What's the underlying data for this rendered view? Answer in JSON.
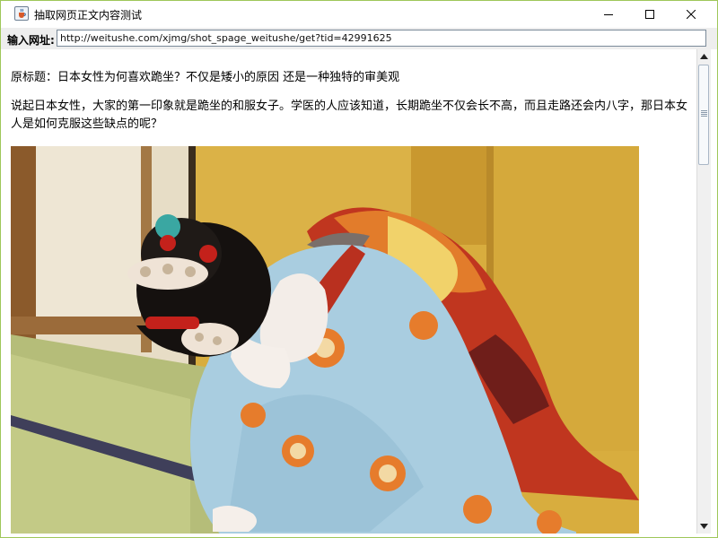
{
  "window": {
    "title": "抽取网页正文内容测试",
    "app_icon": "java-cup-icon",
    "controls": [
      "minimize-icon",
      "maximize-icon",
      "close-icon"
    ]
  },
  "url_bar": {
    "label": "输入网址:",
    "value": "http://weitushe.com/xjmg/shot_spage_weitushe/get?tid=42991625"
  },
  "article": {
    "title": "原标题：日本女性为何喜欢跪坐？不仅是矮小的原因 还是一种独特的审美观",
    "body": "说起日本女性，大家的第一印象就是跪坐的和服女子。学医的人应该知道，长期跪坐不仅会长不高，而且走路还会内八字，那日本女人是如何克服这些缺点的呢？",
    "image_icon": "photo-geisha-bowing"
  },
  "scrollbar": {
    "position": 0.0,
    "up_icon": "arrow-up-icon",
    "down_icon": "arrow-down-icon"
  },
  "colors": {
    "window_border": "#9fc75a",
    "toolbar_bg": "#eeeeee",
    "wall_gold": "#d6a93a",
    "kimono_blue": "#a9cde0",
    "obi_red": "#b9301f"
  }
}
